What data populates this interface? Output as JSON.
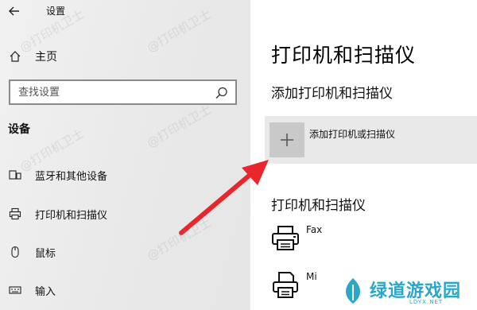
{
  "window": {
    "title": "设置",
    "back_icon": "arrow-left-icon"
  },
  "sidebar": {
    "home": {
      "label": "主页",
      "icon": "home-icon"
    },
    "search": {
      "placeholder": "查找设置",
      "icon": "search-icon"
    },
    "section_heading": "设备",
    "items": [
      {
        "label": "蓝牙和其他设备",
        "icon": "bluetooth-devices-icon"
      },
      {
        "label": "打印机和扫描仪",
        "icon": "printer-icon"
      },
      {
        "label": "鼠标",
        "icon": "mouse-icon"
      },
      {
        "label": "输入",
        "icon": "keyboard-icon"
      }
    ]
  },
  "main": {
    "page_title": "打印机和扫描仪",
    "add_section_heading": "添加打印机和扫描仪",
    "add_button_label": "添加打印机或扫描仪",
    "list_heading": "打印机和扫描仪",
    "devices": [
      {
        "name": "Fax",
        "icon": "fax-printer-icon"
      },
      {
        "name": "Mi",
        "icon": "document-printer-icon"
      }
    ]
  },
  "annotation": {
    "arrow_color": "#e8262b"
  },
  "watermark": {
    "text": "@打印机卫士"
  },
  "logo": {
    "text": "绿道游戏园",
    "subtext": "LDYX.NET",
    "color": "#2aa7c8"
  }
}
